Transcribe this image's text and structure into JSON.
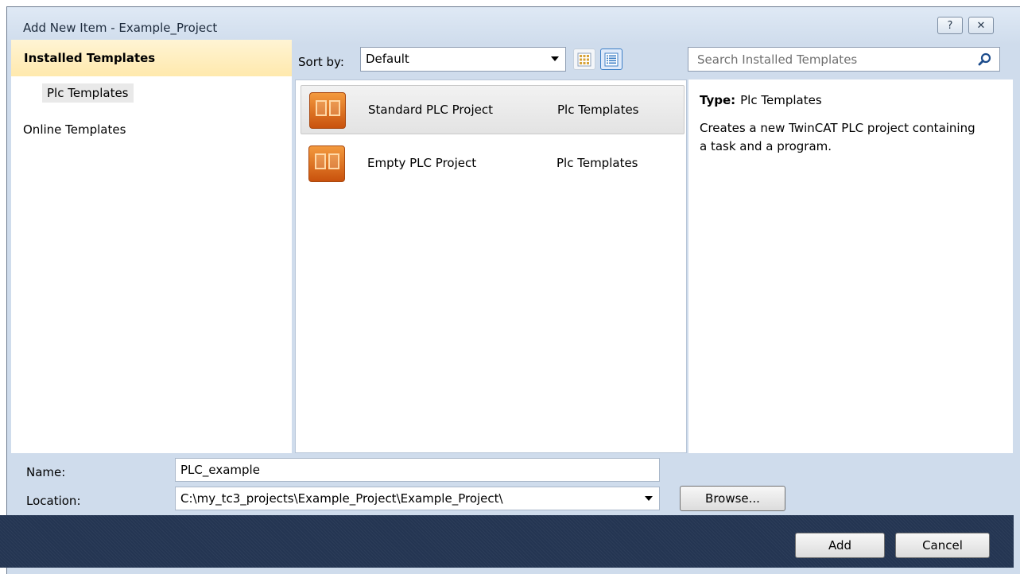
{
  "window": {
    "title": "Add New Item - Example_Project",
    "help_glyph": "?",
    "close_glyph": "✕"
  },
  "left_pane": {
    "header": "Installed Templates",
    "items": [
      {
        "label": "Plc Templates",
        "selected": true
      },
      {
        "label": "Online Templates",
        "selected": false
      }
    ]
  },
  "toolbar": {
    "sort_label": "Sort by:",
    "sort_value": "Default",
    "view_buttons": [
      "medium-icons-view-icon",
      "small-icons-view-icon"
    ],
    "active_view": "small-icons-view-icon"
  },
  "search": {
    "placeholder": "Search Installed Templates",
    "value": "",
    "icon": "search-icon"
  },
  "templates": [
    {
      "name": "Standard PLC Project",
      "category": "Plc Templates",
      "icon": "plc-project-icon",
      "selected": true
    },
    {
      "name": "Empty PLC Project",
      "category": "Plc Templates",
      "icon": "plc-project-icon",
      "selected": false
    }
  ],
  "info": {
    "type_label": "Type:",
    "type_value": "Plc Templates",
    "description": "Creates a new TwinCAT PLC project containing a task and a program."
  },
  "form": {
    "name_label": "Name:",
    "name_value": "PLC_example",
    "location_label": "Location:",
    "location_value": "C:\\my_tc3_projects\\Example_Project\\Example_Project\\",
    "browse_label": "Browse..."
  },
  "buttons": {
    "add": "Add",
    "cancel": "Cancel"
  },
  "colors": {
    "header_highlight": "#ffe9ad",
    "footer": "#243552",
    "icon_orange": "#e0701f"
  }
}
